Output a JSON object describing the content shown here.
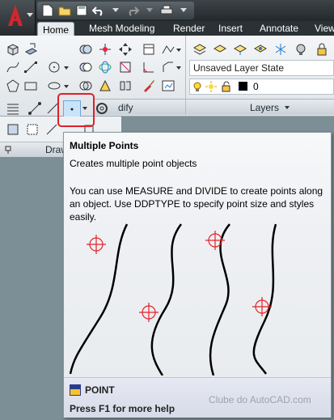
{
  "tabs": [
    {
      "label": "Home",
      "active": true
    },
    {
      "label": "Mesh Modeling",
      "active": false
    },
    {
      "label": "Render",
      "active": false
    },
    {
      "label": "Insert",
      "active": false
    },
    {
      "label": "Annotate",
      "active": false
    },
    {
      "label": "View",
      "active": false
    }
  ],
  "ribbon": {
    "modify_panel_label": "dify",
    "layers_panel_label": "Layers",
    "layer_state_value": "Unsaved Layer State",
    "layer_current_value": "0",
    "draw_panel_label": "Draw"
  },
  "tooltip": {
    "title": "Multiple Points",
    "description": "Creates multiple point objects",
    "body": "You can use MEASURE and DIVIDE to create points along an object. Use DDPTYPE to specify point size and styles easily.",
    "command": "POINT",
    "help": "Press F1 for more help"
  },
  "watermark": "Clube do AutoCAD.com",
  "colors": {
    "accent_red": "#e0202a",
    "titlebar": "#22282b",
    "point_marker": "#e3222a"
  }
}
